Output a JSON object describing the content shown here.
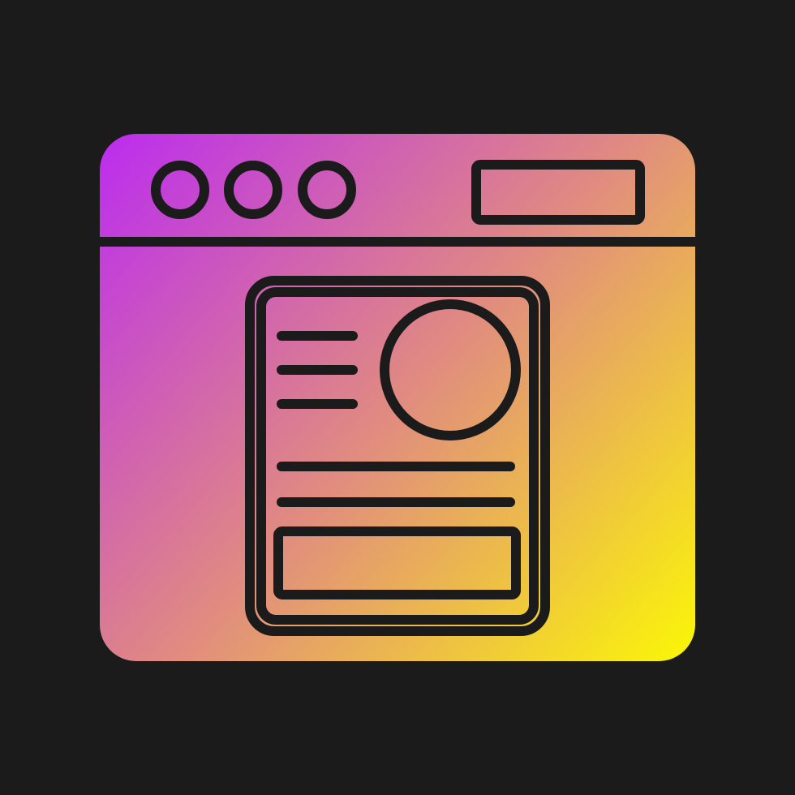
{
  "background_color": "#1b1b1b",
  "icon": {
    "name": "browser-profile-card-icon",
    "gradient_start": "#bb2cf0",
    "gradient_mid": "#e08a82",
    "gradient_end": "#fbf706",
    "stroke_color": "#1b1b1b",
    "window_control_count": 3,
    "card_text_line_count": 3,
    "card_detail_line_count": 2
  }
}
